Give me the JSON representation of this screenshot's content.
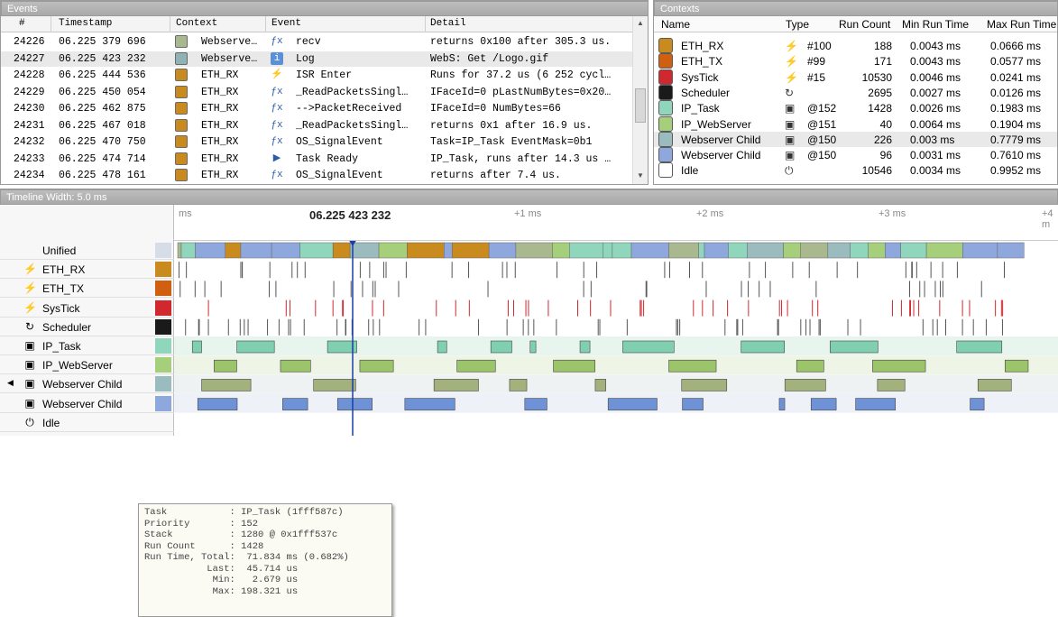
{
  "events_panel": {
    "title": "Events",
    "columns": [
      "#",
      "Timestamp",
      "Context",
      "Event",
      "Detail"
    ],
    "rows": [
      {
        "num": "24226",
        "ts": "06.225 379 696",
        "ctx": "Webserve…",
        "ctx_color": "#aab890",
        "icon": "fx",
        "event": "recv",
        "detail": "returns 0x100 after 305.3 us."
      },
      {
        "num": "24227",
        "ts": "06.225 423 232",
        "ctx": "Webserve…",
        "ctx_color": "#8fb3b4",
        "icon": "info",
        "event": "Log",
        "detail": "WebS: Get /Logo.gif",
        "selected": true
      },
      {
        "num": "24228",
        "ts": "06.225 444 536",
        "ctx": "ETH_RX",
        "ctx_color": "#c98a1e",
        "icon": "isr",
        "event": "ISR Enter",
        "detail": "Runs for 37.2 us (6 252 cycl…"
      },
      {
        "num": "24229",
        "ts": "06.225 450 054",
        "ctx": "ETH_RX",
        "ctx_color": "#c98a1e",
        "icon": "fx",
        "event": "_ReadPacketsSingl…",
        "detail": "IFaceId=0 pLastNumBytes=0x20…"
      },
      {
        "num": "24230",
        "ts": "06.225 462 875",
        "ctx": "ETH_RX",
        "ctx_color": "#c98a1e",
        "icon": "fx",
        "event": "-->PacketReceived",
        "detail": "IFaceId=0 NumBytes=66"
      },
      {
        "num": "24231",
        "ts": "06.225 467 018",
        "ctx": "ETH_RX",
        "ctx_color": "#c98a1e",
        "icon": "fx",
        "event": "_ReadPacketsSingl…",
        "detail": "returns 0x1 after 16.9 us."
      },
      {
        "num": "24232",
        "ts": "06.225 470 750",
        "ctx": "ETH_RX",
        "ctx_color": "#c98a1e",
        "icon": "signal",
        "event": "OS_SignalEvent",
        "detail": "Task=IP_Task EventMask=0b1"
      },
      {
        "num": "24233",
        "ts": "06.225 474 714",
        "ctx": "ETH_RX",
        "ctx_color": "#c98a1e",
        "icon": "ready",
        "event": "Task Ready",
        "detail": "IP_Task, runs after 14.3 us …"
      },
      {
        "num": "24234",
        "ts": "06.225 478 161",
        "ctx": "ETH_RX",
        "ctx_color": "#c98a1e",
        "icon": "fx",
        "event": "OS_SignalEvent",
        "detail": "returns after 7.4 us."
      }
    ]
  },
  "contexts_panel": {
    "title": "Contexts",
    "columns": [
      "Name",
      "Type",
      "Run Count",
      "Min Run Time",
      "Max Run Time"
    ],
    "rows": [
      {
        "name": "ETH_RX",
        "color": "#c98a1e",
        "type_icon": "lightning-icon",
        "type": "#100",
        "count": "188",
        "min": "0.0043 ms",
        "max": "0.0666 ms"
      },
      {
        "name": "ETH_TX",
        "color": "#d06010",
        "type_icon": "lightning-icon",
        "type": "#99",
        "count": "171",
        "min": "0.0043 ms",
        "max": "0.0577 ms"
      },
      {
        "name": "SysTick",
        "color": "#d0282e",
        "type_icon": "lightning-icon",
        "type": "#15",
        "count": "10530",
        "min": "0.0046 ms",
        "max": "0.0241 ms"
      },
      {
        "name": "Scheduler",
        "color": "#1a1a1a",
        "type_icon": "cycle-icon",
        "type": "",
        "count": "2695",
        "min": "0.0027 ms",
        "max": "0.0126 ms"
      },
      {
        "name": "IP_Task",
        "color": "#8fd6bd",
        "type_icon": "task-icon",
        "type": "@152",
        "count": "1428",
        "min": "0.0026 ms",
        "max": "0.1983 ms"
      },
      {
        "name": "IP_WebServer",
        "color": "#a5cf7a",
        "type_icon": "task-icon",
        "type": "@151",
        "count": "40",
        "min": "0.0064 ms",
        "max": "0.1904 ms"
      },
      {
        "name": "Webserver Child",
        "color": "#9bbcbf",
        "type_icon": "task-icon",
        "type": "@150",
        "count": "226",
        "min": "0.003 ms",
        "max": "0.7779 ms",
        "selected": true
      },
      {
        "name": "Webserver Child",
        "color": "#8ea8dd",
        "type_icon": "task-icon",
        "type": "@150",
        "count": "96",
        "min": "0.0031 ms",
        "max": "0.7610 ms"
      },
      {
        "name": "Idle",
        "color": "#ffffff",
        "type_icon": "power-icon",
        "type": "",
        "count": "10546",
        "min": "0.0034 ms",
        "max": "0.9952 ms"
      }
    ]
  },
  "timeline": {
    "title": "Timeline  Width: 5.0 ms",
    "cursor_time": "06.225 423 232",
    "ticks": [
      "ms",
      "+1 ms",
      "+2 ms",
      "+3 ms",
      "+4 m"
    ],
    "rows": [
      {
        "label": "Unified",
        "icon": "",
        "color": "#d6dce8"
      },
      {
        "label": "ETH_RX",
        "icon": "lightning-icon",
        "color": "#c98a1e"
      },
      {
        "label": "ETH_TX",
        "icon": "lightning-icon",
        "color": "#d06010"
      },
      {
        "label": "SysTick",
        "icon": "lightning-icon",
        "color": "#d0282e"
      },
      {
        "label": "Scheduler",
        "icon": "cycle-icon",
        "color": "#1a1a1a"
      },
      {
        "label": "IP_Task",
        "icon": "task-icon",
        "color": "#8fd6bd"
      },
      {
        "label": "IP_WebServer",
        "icon": "task-icon",
        "color": "#a5cf7a"
      },
      {
        "label": "Webserver Child",
        "icon": "task-icon",
        "color": "#9bbcbf",
        "marker": "◀"
      },
      {
        "label": "Webserver Child",
        "icon": "task-icon",
        "color": "#8ea8dd"
      },
      {
        "label": "Idle",
        "icon": "power-icon",
        "color": "#ffffff"
      }
    ]
  },
  "tooltip": {
    "lines": [
      "Task           : IP_Task (1fff587c)",
      "Priority       : 152",
      "Stack          : 1280 @ 0x1fff537c",
      "Run Count      : 1428",
      "Run Time, Total:  71.834 ms (0.682%)",
      "           Last:  45.714 us",
      "            Min:   2.679 us",
      "            Max: 198.321 us"
    ]
  }
}
